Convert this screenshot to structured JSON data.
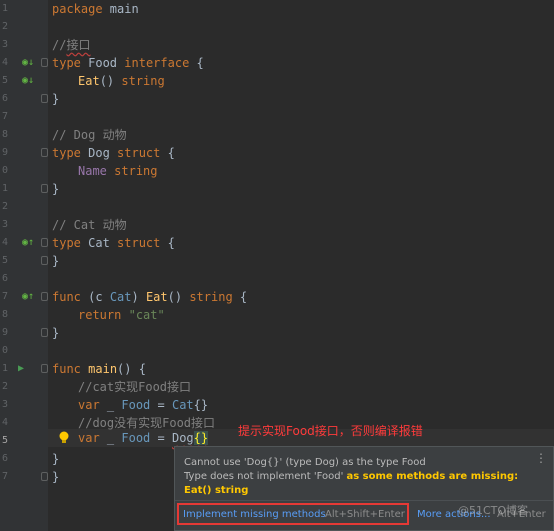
{
  "editor": {
    "gutter": {
      "line_number_fragments": [
        "1",
        "2",
        "3",
        "4",
        "5",
        "6",
        "7",
        "8",
        "9",
        "0",
        "1",
        "2",
        "3",
        "4",
        "5",
        "6",
        "7",
        "8",
        "9",
        "0",
        "1",
        "2",
        "3",
        "4",
        "5",
        "6",
        "7"
      ]
    },
    "lines": {
      "l1": {
        "kw": "package",
        "rest": " main"
      },
      "l3": {
        "comment_prefix": "//",
        "comment_word": "接口"
      },
      "l4": {
        "kw1": "type",
        "name": " Food ",
        "kw2": "interface",
        "rest": " {"
      },
      "l5": {
        "fn": "Eat",
        "mid": "() ",
        "kw": "string"
      },
      "l6": {
        "text": "}"
      },
      "l8": {
        "comment": "// Dog 动物"
      },
      "l9": {
        "kw1": "type",
        "name": " Dog ",
        "kw2": "struct",
        "rest": " {"
      },
      "l10": {
        "field": "Name",
        "sp": " ",
        "kw": "string"
      },
      "l11": {
        "text": "}"
      },
      "l13": {
        "comment": "// Cat 动物"
      },
      "l14": {
        "kw1": "type",
        "name": " Cat ",
        "kw2": "struct",
        "rest": " {"
      },
      "l15": {
        "text": "}"
      },
      "l17": {
        "kw": "func",
        "p1": " (c ",
        "recv": "Cat",
        "p2": ") ",
        "fn": "Eat",
        "p3": "() ",
        "kw2": "string",
        "p4": " {"
      },
      "l18": {
        "kw": "return",
        "sp": " ",
        "str": "\"cat\""
      },
      "l19": {
        "text": "}"
      },
      "l21": {
        "kw": "func",
        "sp": " ",
        "fn": "main",
        "rest": "() {"
      },
      "l22": {
        "comment": "//cat实现Food接口"
      },
      "l23": {
        "kw": "var",
        "p1": " _ ",
        "ty": "Food",
        "p2": " = ",
        "ctor": "Cat",
        "rest": "{}"
      },
      "l24": {
        "comment": "//dog没有实现Food接口"
      },
      "l25": {
        "kw": "var",
        "p1": " _ ",
        "ty": "Food",
        "p2": " = ",
        "ctor": "Dog",
        "rest": "{}"
      },
      "l26": {
        "text": "}"
      },
      "l27": {
        "text": "}"
      }
    }
  },
  "annotation": "提示实现Food接口，否则编译报错",
  "popup": {
    "line1": "Cannot use 'Dog{}' (type Dog) as the type Food",
    "line2_plain": "Type does not implement 'Food' ",
    "line2_bold": "as some methods are missing:",
    "line3": "Eat() string",
    "action_primary": "Implement missing methods",
    "action_primary_shortcut": "Alt+Shift+Enter",
    "action_more": "More actions...",
    "action_more_shortcut": "Alt+Enter",
    "menu_glyph": "⋮"
  },
  "watermark": "@51CTO博客",
  "colors": {
    "keyword": "#cc7832",
    "string": "#6a8759",
    "comment": "#808080",
    "function": "#ffc66d",
    "field": "#9876aa",
    "annotation_red": "#ff3b3b",
    "link_blue": "#589df6",
    "warning_yellow": "#ffc800"
  }
}
